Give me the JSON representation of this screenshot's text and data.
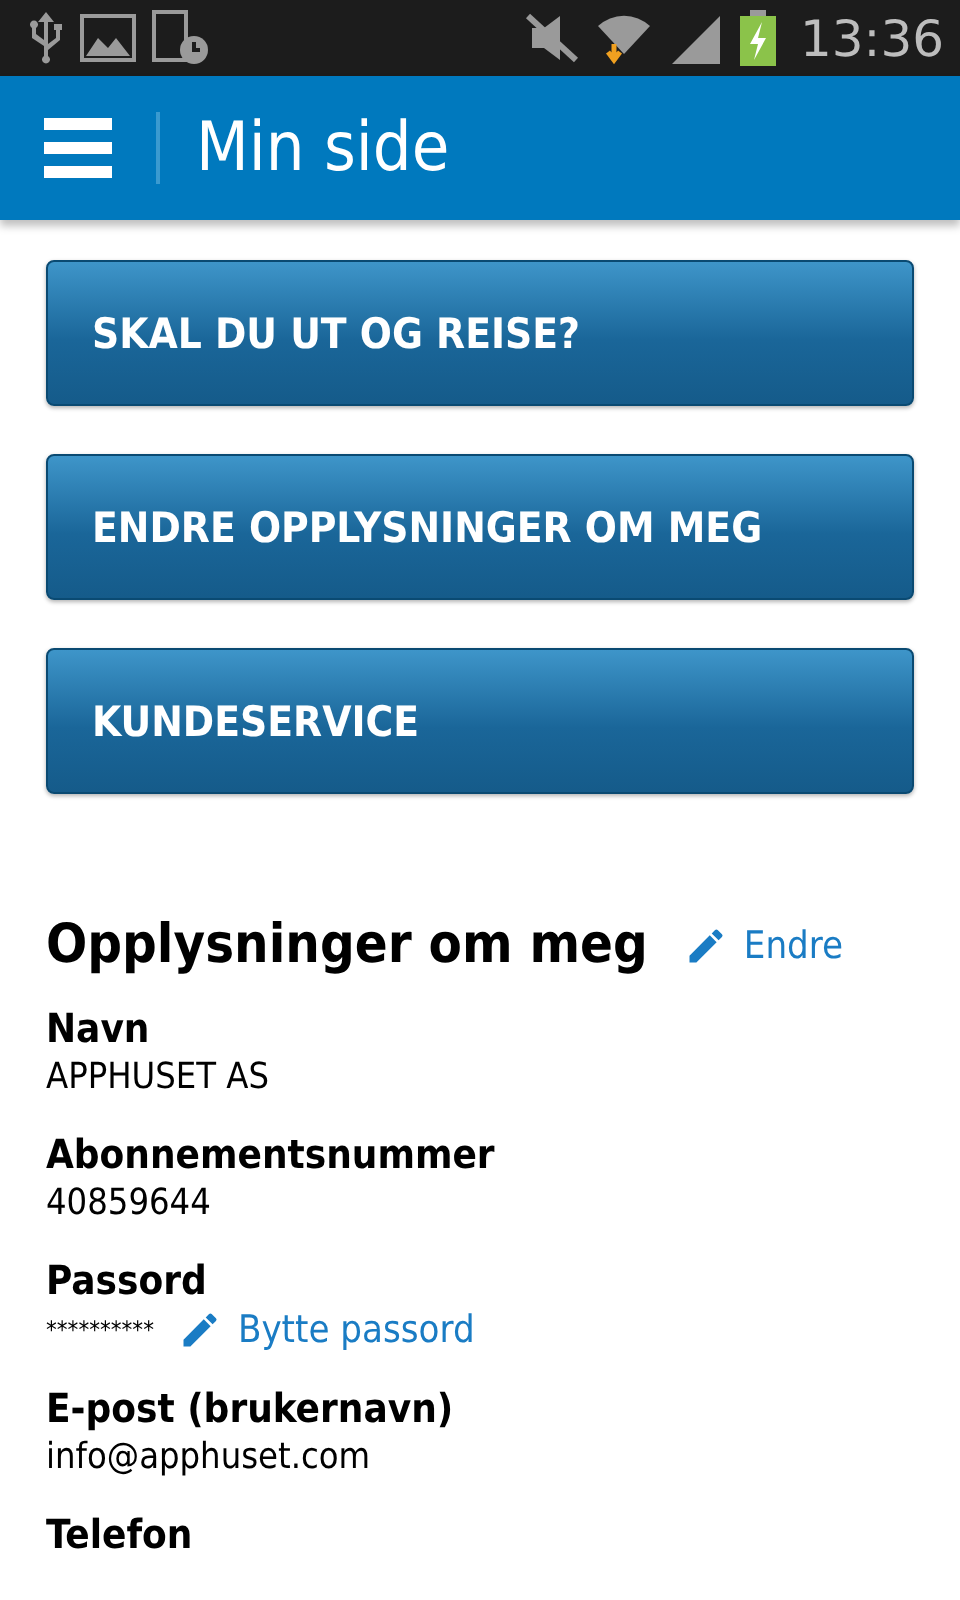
{
  "status_bar": {
    "time": "13:36"
  },
  "app_bar": {
    "title": "Min side"
  },
  "menu_buttons": [
    {
      "label": "SKAL DU UT OG REISE?"
    },
    {
      "label": "ENDRE OPPLYSNINGER OM MEG"
    },
    {
      "label": "KUNDESERVICE"
    }
  ],
  "section": {
    "title": "Opplysninger om meg",
    "edit_link": "Endre",
    "fields": [
      {
        "label": "Navn",
        "value": "APPHUSET AS"
      },
      {
        "label": "Abonnementsnummer",
        "value": "40859644"
      },
      {
        "label": "Passord",
        "value": "**********",
        "link": "Bytte passord"
      },
      {
        "label": "E-post (brukernavn)",
        "value": "info@apphuset.com"
      },
      {
        "label": "Telefon"
      }
    ]
  }
}
